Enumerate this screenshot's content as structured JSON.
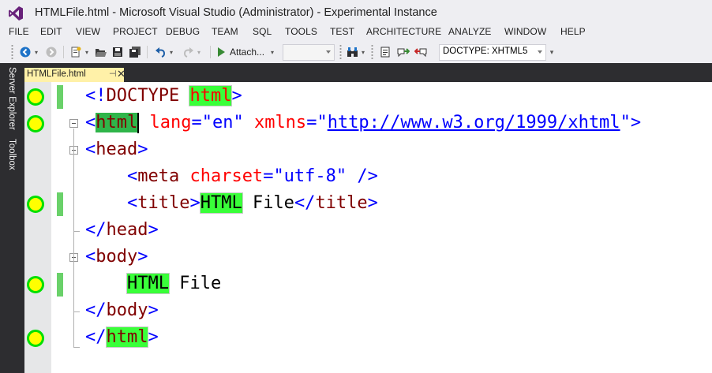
{
  "window": {
    "title": "HTMLFile.html - Microsoft Visual Studio (Administrator) - Experimental Instance"
  },
  "menu": [
    "FILE",
    "EDIT",
    "VIEW",
    "PROJECT",
    "DEBUG",
    "TEAM",
    "SQL",
    "TOOLS",
    "TEST",
    "ARCHITECTURE",
    "ANALYZE",
    "WINDOW",
    "HELP"
  ],
  "toolbar": {
    "attach_label": "Attach...",
    "doctype_value": "DOCTYPE: XHTML5"
  },
  "side_panels": {
    "server_explorer": "Server Explorer",
    "toolbox": "Toolbox"
  },
  "document_tab": {
    "name": "HTMLFile.html",
    "pin_glyph": "⊣",
    "close_glyph": "✕"
  },
  "code": {
    "l1": {
      "open": "<!",
      "doctype": "DOCTYPE ",
      "html": "html",
      "close": ">"
    },
    "l2": {
      "open": "<",
      "tag": "html",
      "attr1": " lang",
      "eq1": "=",
      "val1": "\"en\"",
      "attr2": " xmlns",
      "eq2": "=",
      "q1": "\"",
      "url": "http://www.w3.org/1999/xhtml",
      "q2": "\"",
      "close": ">"
    },
    "l3": {
      "open": "<",
      "tag": "head",
      "close": ">"
    },
    "l4": {
      "indent": "    ",
      "open": "<",
      "tag": "meta",
      "attr": " charset",
      "eq": "=",
      "val": "\"utf-8\"",
      "close": " />"
    },
    "l5": {
      "indent": "    ",
      "open": "<",
      "tag": "title",
      "close": ">",
      "hl": "HTML",
      "text": " File",
      "open2": "</",
      "tag2": "title",
      "close2": ">"
    },
    "l6": {
      "open": "</",
      "tag": "head",
      "close": ">"
    },
    "l7": {
      "open": "<",
      "tag": "body",
      "close": ">"
    },
    "l8": {
      "indent": "    ",
      "hl": "HTML",
      "text": " File"
    },
    "l9": {
      "open": "</",
      "tag": "body",
      "close": ">"
    },
    "l10": {
      "open": "</",
      "tag": "html",
      "close": ">"
    }
  },
  "colors": {
    "tag": "#800000",
    "delimiter": "#0000ff",
    "attribute": "#ff0000",
    "highlight": "#39ff39",
    "breakpoint_fill": "#ffff00",
    "breakpoint_ring": "#00e000",
    "change_bar": "#6ad16a"
  }
}
